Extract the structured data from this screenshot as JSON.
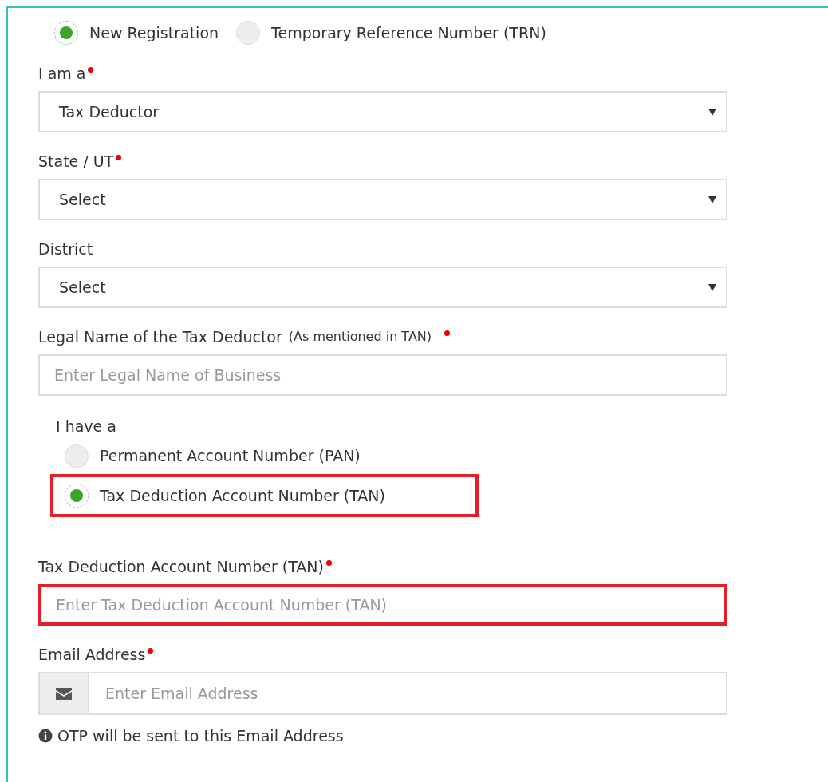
{
  "registration_type": [
    {
      "label": "New Registration",
      "selected": true
    },
    {
      "label": "Temporary Reference Number (TRN)",
      "selected": false
    }
  ],
  "fields": [
    {
      "kind": "select",
      "label": "I am a",
      "required": true,
      "value": "Tax Deductor"
    },
    {
      "kind": "select",
      "label": "State / UT",
      "required": true,
      "value": "Select"
    },
    {
      "kind": "select",
      "label": "District",
      "required": false,
      "value": "Select"
    },
    {
      "kind": "text",
      "label": "Legal Name of the Tax Deductor",
      "hint": "(As mentioned in TAN)",
      "required": true,
      "placeholder": "Enter Legal Name of Business",
      "highlighted": false
    },
    {
      "kind": "radio_group",
      "label": "I have a",
      "options": [
        {
          "label": "Permanent Account Number (PAN)",
          "selected": false,
          "highlighted": false
        },
        {
          "label": "Tax Deduction Account Number (TAN)",
          "selected": true,
          "highlighted": true
        }
      ]
    },
    {
      "kind": "text",
      "label": "Tax Deduction Account Number (TAN)",
      "required": true,
      "placeholder": "Enter Tax Deduction Account Number (TAN)",
      "highlighted": true
    },
    {
      "kind": "email",
      "label": "Email Address",
      "required": true,
      "placeholder": "Enter Email Address",
      "help": "OTP will be sent to this Email Address"
    }
  ]
}
